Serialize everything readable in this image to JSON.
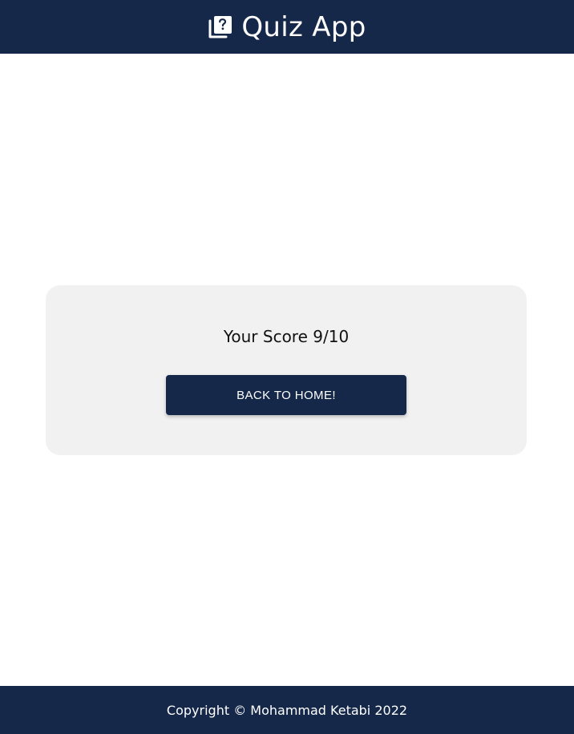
{
  "header": {
    "title": "Quiz App",
    "icon": "quiz-library-icon"
  },
  "result": {
    "score_prefix": "Your Score",
    "score_value": "9/10",
    "score_text": "Your Score 9/10",
    "back_button_label": "BACK TO HOME!"
  },
  "footer": {
    "copyright": "Copyright © Mohammad Ketabi 2022"
  },
  "colors": {
    "brand": "#15284a",
    "card_background": "#f1f1f1",
    "text": "#111111"
  }
}
